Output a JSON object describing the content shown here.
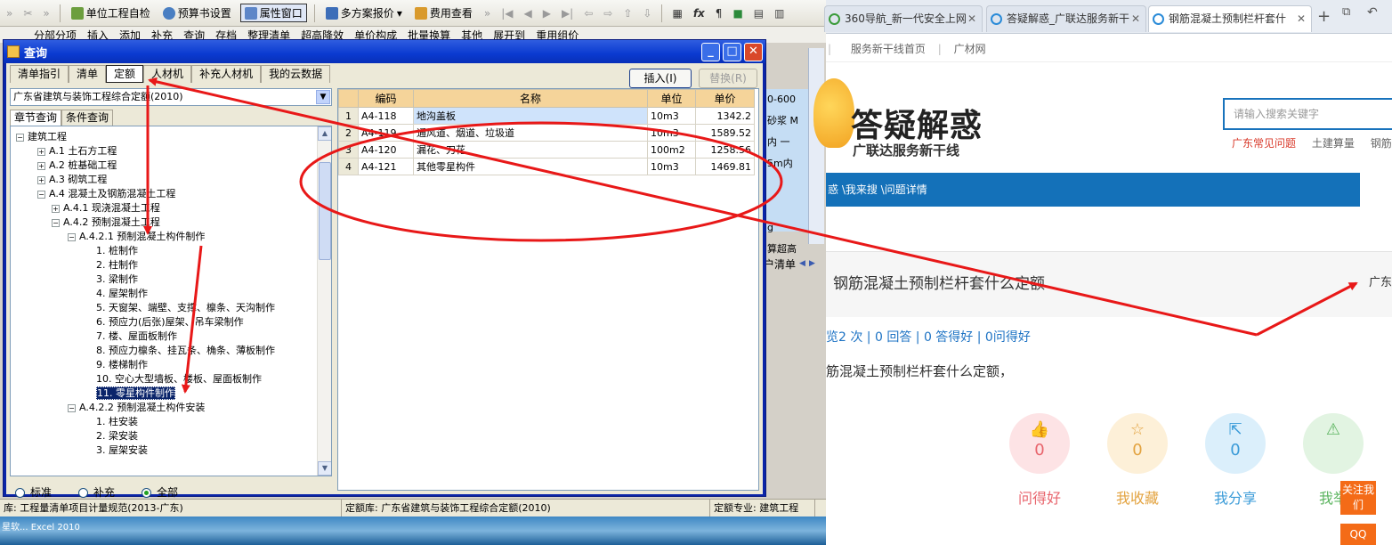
{
  "toolbar1": {
    "unit_check": "单位工程自检",
    "budget_settings": "预算书设置",
    "property_window": "属性窗口",
    "multi_plan": "多方案报价",
    "cost_view": "费用查看"
  },
  "toolbar2": {
    "items": [
      "分部分项",
      "插入",
      "添加",
      "补充",
      "查询",
      "存档",
      "整理清单",
      "超高降效",
      "单价构成",
      "批量换算",
      "其他",
      "展开到",
      "重用组价"
    ]
  },
  "query_window": {
    "title": "查询",
    "tabs": [
      "清单指引",
      "清单",
      "定额",
      "人材机",
      "补充人材机",
      "我的云数据"
    ],
    "insert_label": "插入(I)",
    "replace_label": "替换(R)",
    "dinge_library": "广东省建筑与装饰工程综合定额(2010)",
    "sub_tabs": [
      "章节查询",
      "条件查询"
    ],
    "tree": [
      {
        "label": "建筑工程",
        "expander": "⊟"
      },
      {
        "label": "A.1 土石方工程",
        "expander": "⊞"
      },
      {
        "label": "A.2 桩基础工程",
        "expander": "⊞"
      },
      {
        "label": "A.3 砌筑工程",
        "expander": "⊞"
      },
      {
        "label": "A.4 混凝土及钢筋混凝土工程",
        "expander": "⊟"
      },
      {
        "label": "A.4.1 现浇混凝土工程",
        "expander": "⊞"
      },
      {
        "label": "A.4.2 预制混凝土工程",
        "expander": "⊟"
      },
      {
        "label": "A.4.2.1 预制混凝土构件制作",
        "expander": "⊟"
      },
      {
        "label": "1. 桩制作"
      },
      {
        "label": "2. 柱制作"
      },
      {
        "label": "3. 梁制作"
      },
      {
        "label": "4. 屋架制作"
      },
      {
        "label": "5. 天窗架、端壁、支撑、檩条、天沟制作"
      },
      {
        "label": "6. 预应力(后张)屋架、吊车梁制作"
      },
      {
        "label": "7. 楼、屋面板制作"
      },
      {
        "label": "8. 预应力檩条、挂瓦条、桷条、薄板制作"
      },
      {
        "label": "9. 楼梯制作"
      },
      {
        "label": "10. 空心大型墙板、楼板、屋面板制作"
      },
      {
        "label": "11. 零星构件制作"
      },
      {
        "label": "A.4.2.2 预制混凝土构件安装",
        "expander": "⊟"
      },
      {
        "label": "1. 柱安装"
      },
      {
        "label": "2. 梁安装"
      },
      {
        "label": "3. 屋架安装"
      }
    ],
    "radios": {
      "standard": "标准",
      "supplement": "补充",
      "all": "全部"
    },
    "grid": {
      "headers": [
        "编码",
        "名称",
        "单位",
        "单价"
      ],
      "rows": [
        {
          "n": "1",
          "code": "A4-118",
          "name": "地沟盖板",
          "unit": "10m3",
          "price": "1342.2"
        },
        {
          "n": "2",
          "code": "A4-119",
          "name": "通风道、烟道、垃圾道",
          "unit": "10m3",
          "price": "1589.52"
        },
        {
          "n": "3",
          "code": "A4-120",
          "name": "漏花、刀花",
          "unit": "100m2",
          "price": "1258.56"
        },
        {
          "n": "4",
          "code": "A4-121",
          "name": "其他零星构件",
          "unit": "10m3",
          "price": "1469.81"
        }
      ]
    }
  },
  "rightpane": {
    "lines": [
      "0-600",
      "砂浆 M",
      "内 一",
      "5m内",
      "",
      "",
      "g",
      "算超高"
    ],
    "footer": "户清单"
  },
  "statusbar": {
    "qingdan": "库: 工程量清单项目计量规范(2013-广东)",
    "dinge": "定额库: 广东省建筑与装饰工程综合定额(2010)",
    "major": "定额专业: 建筑工程"
  },
  "taskbar": {
    "label": "星软... Excel 2010"
  },
  "browser": {
    "tabs": [
      "360导航_新一代安全上网",
      "答疑解惑_广联达服务新干",
      "钢筋混凝土预制栏杆套什"
    ],
    "subnav": [
      "服务新干线首页",
      "广材网"
    ],
    "logo_title": "答疑解惑",
    "logo_sub": "广联达服务新干线",
    "search_placeholder": "请输入搜索关键字",
    "hot_links": [
      "广东常见问题",
      "土建算量",
      "钢筋算"
    ],
    "breadcrumb": "惑 \\我来搜 \\问题详情",
    "question_title": "钢筋混凝土预制栏杆套什么定额",
    "region": "广东",
    "stats": "览2 次 | 0 回答 | 0 答得好 | 0问得好",
    "description": "筋混凝土预制栏杆套什么定额，",
    "actions": [
      {
        "label": "问得好",
        "count": "0",
        "color": "#e8646c",
        "bg": "#fde3e5"
      },
      {
        "label": "我收藏",
        "count": "0",
        "color": "#e3a340",
        "bg": "#fdf0d8"
      },
      {
        "label": "我分享",
        "count": "0",
        "color": "#3a9bd8",
        "bg": "#dbeffb"
      },
      {
        "label": "我举",
        "count": "",
        "color": "#5bb45f",
        "bg": "#e2f4e2"
      }
    ],
    "follow": "关注我们",
    "qq": "QQ"
  },
  "colors": {
    "annotation": "#e81818",
    "title_blue": "#0a3ad0",
    "header_orange": "#f5d49a"
  }
}
